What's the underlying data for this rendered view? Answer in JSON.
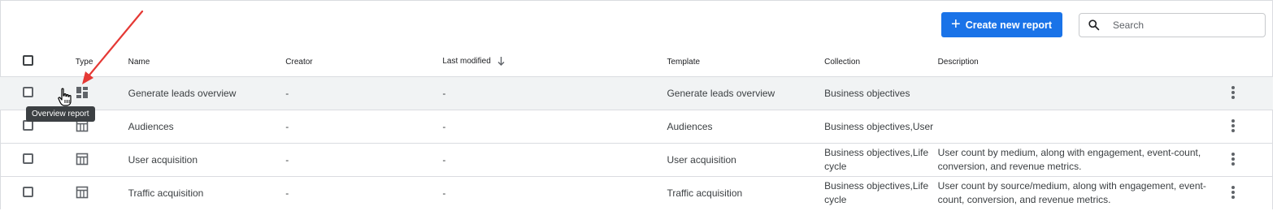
{
  "toolbar": {
    "create_label": "Create new report",
    "search_placeholder": "Search"
  },
  "table": {
    "headers": {
      "type": "Type",
      "name": "Name",
      "creator": "Creator",
      "last_modified": "Last modified",
      "template": "Template",
      "collection": "Collection",
      "description": "Description"
    },
    "rows": [
      {
        "type_icon": "overview-report-icon",
        "name": "Generate leads overview",
        "creator": "-",
        "last_modified": "-",
        "template": "Generate leads overview",
        "collection": "Business objectives",
        "description": ""
      },
      {
        "type_icon": "detail-report-icon",
        "name": "Audiences",
        "creator": "-",
        "last_modified": "-",
        "template": "Audiences",
        "collection": "Business objectives,User",
        "description": ""
      },
      {
        "type_icon": "detail-report-icon",
        "name": "User acquisition",
        "creator": "-",
        "last_modified": "-",
        "template": "User acquisition",
        "collection": "Business objectives,Life cycle",
        "description": "User count by medium, along with engagement, event-count, conversion, and revenue metrics."
      },
      {
        "type_icon": "detail-report-icon",
        "name": "Traffic acquisition",
        "creator": "-",
        "last_modified": "-",
        "template": "Traffic acquisition",
        "collection": "Business objectives,Life cycle",
        "description": "User count by source/medium, along with engagement, event-count, conversion, and revenue metrics."
      }
    ]
  },
  "tooltip": "Overview report",
  "colors": {
    "accent": "#1a73e8",
    "annotation_arrow": "#e53935",
    "row_hover": "#f1f3f4"
  }
}
